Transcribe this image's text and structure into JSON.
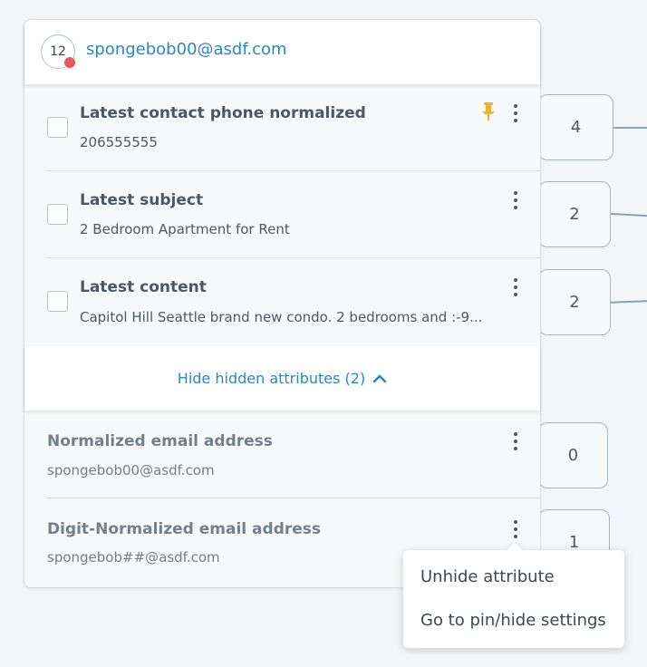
{
  "header": {
    "badge_count": "12",
    "email": "spongebob00@asdf.com"
  },
  "attributes": [
    {
      "title": "Latest contact phone normalized",
      "value": "206555555",
      "pinned": true,
      "count": "4"
    },
    {
      "title": "Latest subject",
      "value": "2 Bedroom Apartment for Rent",
      "pinned": false,
      "count": "2"
    },
    {
      "title": "Latest content",
      "value": "Capitol Hill Seattle brand new condo. 2 bedrooms and :-9...",
      "pinned": false,
      "count": "2"
    }
  ],
  "hide_toggle": {
    "label": "Hide hidden attributes (2)"
  },
  "hidden_attributes": [
    {
      "title": "Normalized email address",
      "value": "spongebob00@asdf.com",
      "count": "0"
    },
    {
      "title": "Digit-Normalized email address",
      "value": "spongebob##@asdf.com",
      "count": "1"
    }
  ],
  "context_menu": {
    "items": [
      "Unhide attribute",
      "Go to pin/hide settings"
    ]
  },
  "colors": {
    "accent": "#2b87c8",
    "pin": "#f0b323",
    "badge_dot": "#e45b5b"
  },
  "icons": [
    "pin-icon",
    "kebab-menu-icon",
    "chevron-up-icon",
    "status-dot-icon"
  ]
}
